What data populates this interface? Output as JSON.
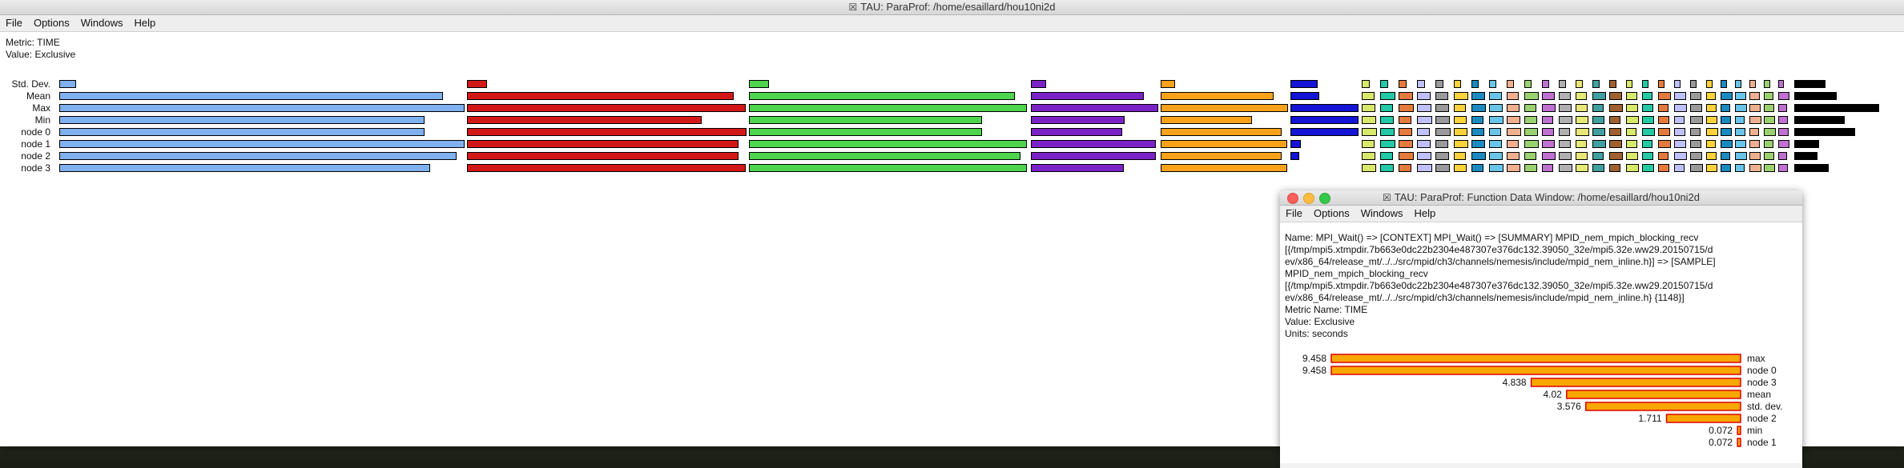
{
  "main_window": {
    "title": "TAU: ParaProf: /home/esaillard/hou10ni2d",
    "menu": [
      "File",
      "Options",
      "Windows",
      "Help"
    ],
    "metric_line": "Metric: TIME",
    "value_line": "Value: Exclusive",
    "rows": [
      "Std. Dev.",
      "Mean",
      "Max",
      "Min",
      "node 0",
      "node 1",
      "node 2",
      "node 3"
    ]
  },
  "function_window": {
    "title": "TAU: ParaProf: Function Data Window: /home/esaillard/hou10ni2d",
    "menu": [
      "File",
      "Options",
      "Windows",
      "Help"
    ],
    "info_lines": [
      "Name: MPI_Wait() => [CONTEXT] MPI_Wait() => [SUMMARY] MPID_nem_mpich_blocking_recv",
      "[{/tmp/mpi5.xtmpdir.7b663e0dc22b2304e487307e376dc132.39050_32e/mpi5.32e.ww29.20150715/d",
      "ev/x86_64/release_mt/../../src/mpid/ch3/channels/nemesis/include/mpid_nem_inline.h}] => [SAMPLE]",
      "MPID_nem_mpich_blocking_recv",
      "[{/tmp/mpi5.xtmpdir.7b663e0dc22b2304e487307e376dc132.39050_32e/mpi5.32e.ww29.20150715/d",
      "ev/x86_64/release_mt/../../src/mpid/ch3/channels/nemesis/include/mpid_nem_inline.h} {1148}]",
      "Metric Name: TIME",
      "Value: Exclusive",
      "Units: seconds"
    ],
    "bar_color": "#f7a800",
    "bar_border": "#e00000",
    "bar_max": 9.458,
    "bars": [
      {
        "value": "9.458",
        "label": "max",
        "v": 9.458
      },
      {
        "value": "9.458",
        "label": "node 0",
        "v": 9.458
      },
      {
        "value": "4.838",
        "label": "node 3",
        "v": 4.838
      },
      {
        "value": "4.02",
        "label": "mean",
        "v": 4.02
      },
      {
        "value": "3.576",
        "label": "std. dev.",
        "v": 3.576
      },
      {
        "value": "1.711",
        "label": "node 2",
        "v": 1.711
      },
      {
        "value": "0.072",
        "label": "min",
        "v": 0.072
      },
      {
        "value": "0.072",
        "label": "node 1",
        "v": 0.072
      }
    ]
  },
  "colors": {
    "blue": "#7fb0f0",
    "red": "#d41818",
    "green": "#4ed44e",
    "purple": "#7b22c7",
    "orange": "#f7a21a",
    "darkblue": "#1414d6"
  }
}
